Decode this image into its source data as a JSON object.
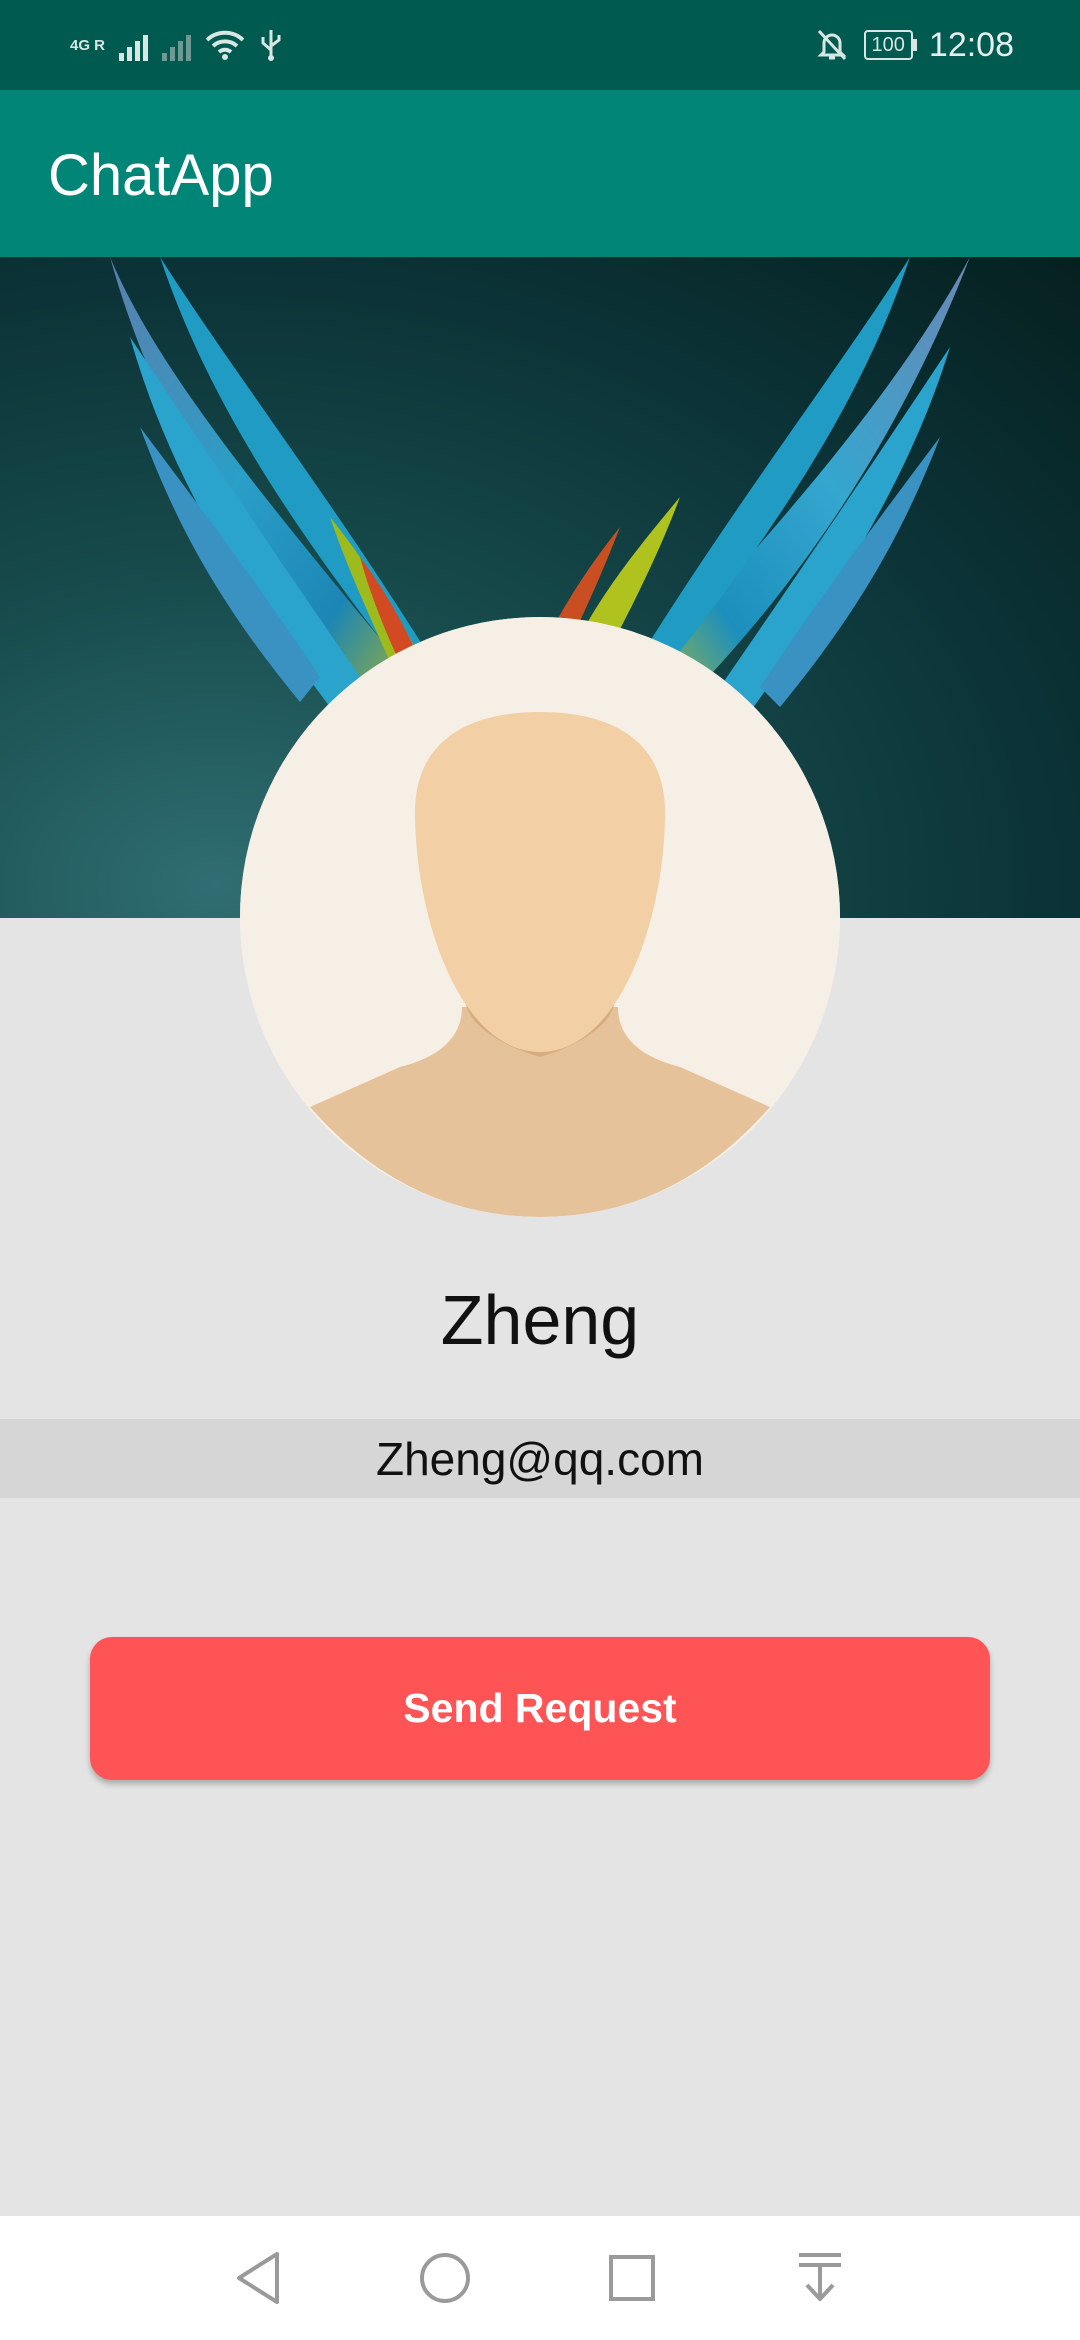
{
  "status_bar": {
    "network_label": "4G R",
    "battery": "100",
    "time": "12:08",
    "icons": [
      "signal-icon",
      "no-signal-icon",
      "wifi-icon",
      "usb-icon",
      "mute-bell-icon",
      "battery-icon"
    ]
  },
  "app_bar": {
    "title": "ChatApp"
  },
  "profile": {
    "name": "Zheng",
    "email": "Zheng@qq.com",
    "cover_image": "parrot-wings-cover",
    "avatar": "default-person-avatar"
  },
  "actions": {
    "send_request_label": "Send Request"
  },
  "colors": {
    "status_bar": "#015a4f",
    "app_bar": "#008577",
    "background": "#e4e4e4",
    "email_strip": "#d6d6d6",
    "button": "#fe5455"
  },
  "nav_bar": {
    "icons": [
      "back-icon",
      "home-icon",
      "recents-icon",
      "notification-pull-icon"
    ]
  }
}
